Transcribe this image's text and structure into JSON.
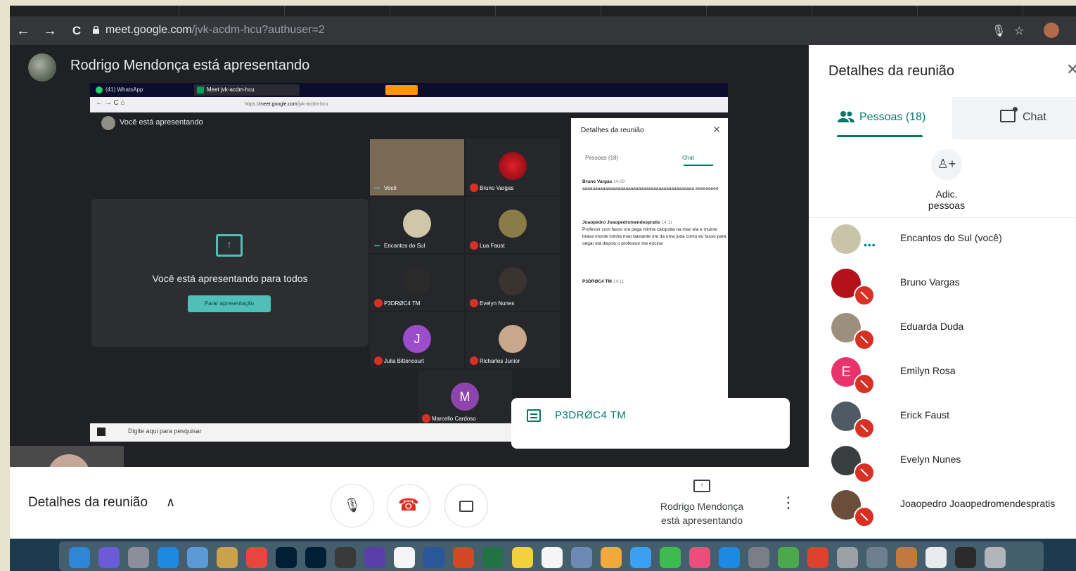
{
  "browser": {
    "url_host": "meet.google.com",
    "url_path": "/jvk-acdm-hcu?authuser=2"
  },
  "stage": {
    "presenter_title": "Rodrigo Mendonça está apresentando"
  },
  "shared_screen": {
    "tabs": [
      "(41) WhatsApp",
      "Meet jvk-acdm-hcu"
    ],
    "url_prefix": "https://",
    "url_host": "meet.google.com",
    "url_path": "/jvk-acdm-hcu",
    "you_presenting": "Você está apresentando",
    "presenting_to_all": "Você está apresentando para todos",
    "stop_button": "Parar apresentação",
    "tiles": [
      {
        "name": "Você",
        "muted": false,
        "speaking": true
      },
      {
        "name": "Bruno Vargas",
        "muted": true
      },
      {
        "name": "Encantos do Sul",
        "muted": false,
        "speaking": true
      },
      {
        "name": "Lua Faust",
        "muted": true
      },
      {
        "name": "P3DRØC4 TM",
        "muted": true
      },
      {
        "name": "Evelyn Nunes",
        "muted": true
      },
      {
        "name": "Julia Bittencourt",
        "muted": true,
        "letter": "J"
      },
      {
        "name": "Richarles Junior",
        "muted": true
      },
      {
        "name": "Marcello Cardoso",
        "muted": true,
        "letter": "M"
      }
    ],
    "panel": {
      "title": "Detalhes da reunião",
      "tab_people": "Pessoas (18)",
      "tab_chat": "Chat",
      "messages": [
        {
          "sender": "Bruno Vargas",
          "time": "14:08",
          "text": "aaaaaaaaaaaaaaaaaaaaaaaaaaaaaaaaaaaaaaaaaaaa eeeeeeeee"
        },
        {
          "sender": "Joaopedro Joaopedromendespratis",
          "time": "14:11",
          "text": "Professir com fasso ora pega minha calopsita na mao ela e muinto brava morde minha mao bastante me da uma juda como eu fasso para oegar ela depois o professor me encina"
        },
        {
          "sender": "P3DRØC4 TM",
          "time": "14:11",
          "text": ""
        }
      ]
    },
    "taskbar_search": "Digite aqui para pesquisar"
  },
  "notification": {
    "sender": "P3DRØC4 TM"
  },
  "controls": {
    "details_label": "Detalhes da reunião",
    "presenting_label": "Rodrigo Mendonça está apresentando"
  },
  "panel": {
    "title": "Detalhes da reunião",
    "tab_people": "Pessoas (18)",
    "tab_chat": "Chat",
    "add_people": "Adic.\npessoas",
    "people": [
      {
        "name": "Encantos do Sul (você)",
        "muted": false,
        "speaking": true,
        "avatar_color": "#c9c3a9"
      },
      {
        "name": "Bruno Vargas",
        "muted": true,
        "avatar_color": "#b3121b"
      },
      {
        "name": "Eduarda Duda",
        "muted": true,
        "avatar_color": "#9c8f7d"
      },
      {
        "name": "Emilyn Rosa",
        "muted": true,
        "letter": "E",
        "avatar_color": "#e8336d"
      },
      {
        "name": "Erick Faust",
        "muted": true,
        "avatar_color": "#4f5b63"
      },
      {
        "name": "Evelyn Nunes",
        "muted": true,
        "avatar_color": "#3b3e40"
      },
      {
        "name": "Joaopedro Joaopedromendespratis",
        "muted": true,
        "avatar_color": "#6b4e3a"
      }
    ]
  },
  "colors": {
    "accent": "#00796b",
    "mute": "#d93025",
    "present_accent": "#4fc0b8"
  },
  "dock_icons": [
    "finder-icon",
    "siri-icon",
    "launchpad-icon",
    "safari-icon",
    "preview-icon",
    "notes-icon",
    "chrome-icon",
    "photoshop-icon",
    "lightroom-icon",
    "final-cut-icon",
    "imovie-icon",
    "calendar-icon",
    "word-icon",
    "powerpoint-icon",
    "excel-icon",
    "notes-app-icon",
    "reminders-icon",
    "preview-app-icon",
    "photos-icon",
    "messages-icon",
    "facetime-icon",
    "itunes-icon",
    "app-store-icon",
    "system-preferences-icon",
    "utorrent-icon",
    "anydesk-icon",
    "automator-icon",
    "image-capture-icon",
    "books-icon",
    "file-icon",
    "terminal-icon",
    "trash-icon"
  ]
}
